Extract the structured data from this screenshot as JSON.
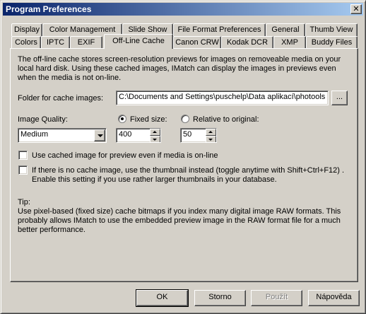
{
  "window": {
    "title": "Program Preferences",
    "close_glyph": "✕"
  },
  "tabs": {
    "row_back": [
      "Display",
      "Color Management",
      "Slide Show",
      "File Format Preferences",
      "General",
      "Thumb View"
    ],
    "row_front": [
      "Colors",
      "IPTC",
      "EXIF",
      "Off-Line Cache",
      "Canon CRW",
      "Kodak DCR",
      "XMP",
      "Buddy Files"
    ],
    "active": "Off-Line Cache"
  },
  "panel": {
    "description": "The off-line cache stores screen-resolution previews for images on removeable media on your local hard disk. Using these cached images, IMatch can display the images in previews even when the media is not on-line.",
    "folder_label": "Folder for cache images:",
    "folder_value": "C:\\Documents and Settings\\puschelp\\Data aplikací\\photools",
    "browse_label": "...",
    "quality_label": "Image Quality:",
    "quality_value": "Medium",
    "fixed_size_label": "Fixed size:",
    "fixed_size_value": "400",
    "fixed_size_selected": true,
    "relative_label": "Relative to original:",
    "relative_value": "50",
    "relative_selected": false,
    "use_cached_label": "Use cached image for preview even if media is on-line",
    "use_cached_checked": false,
    "thumbnail_label_line1": "If there is no cache image, use the thumbnail instead (toggle anytime with Shift+Ctrl+F12) .",
    "thumbnail_label_line2": "Enable this setting if you  use rather larger thumbnails in your database.",
    "thumbnail_checked": false,
    "tip_title": "Tip:",
    "tip_text": "Use pixel-based (fixed size) cache bitmaps if you index many digital image RAW formats. This probably allows IMatch to use the embedded preview image in the RAW format file for a much better performance."
  },
  "buttons": {
    "ok": "OK",
    "cancel": "Storno",
    "apply": "Použít",
    "help": "Nápověda"
  },
  "colors": {
    "title_gradient_start": "#0a246a",
    "title_gradient_end": "#a6caf0",
    "face": "#d4d0c8"
  },
  "icons": {
    "close": "close-icon",
    "dropdown": "chevron-down-icon",
    "spin_up": "spin-up-icon",
    "spin_down": "spin-down-icon"
  }
}
